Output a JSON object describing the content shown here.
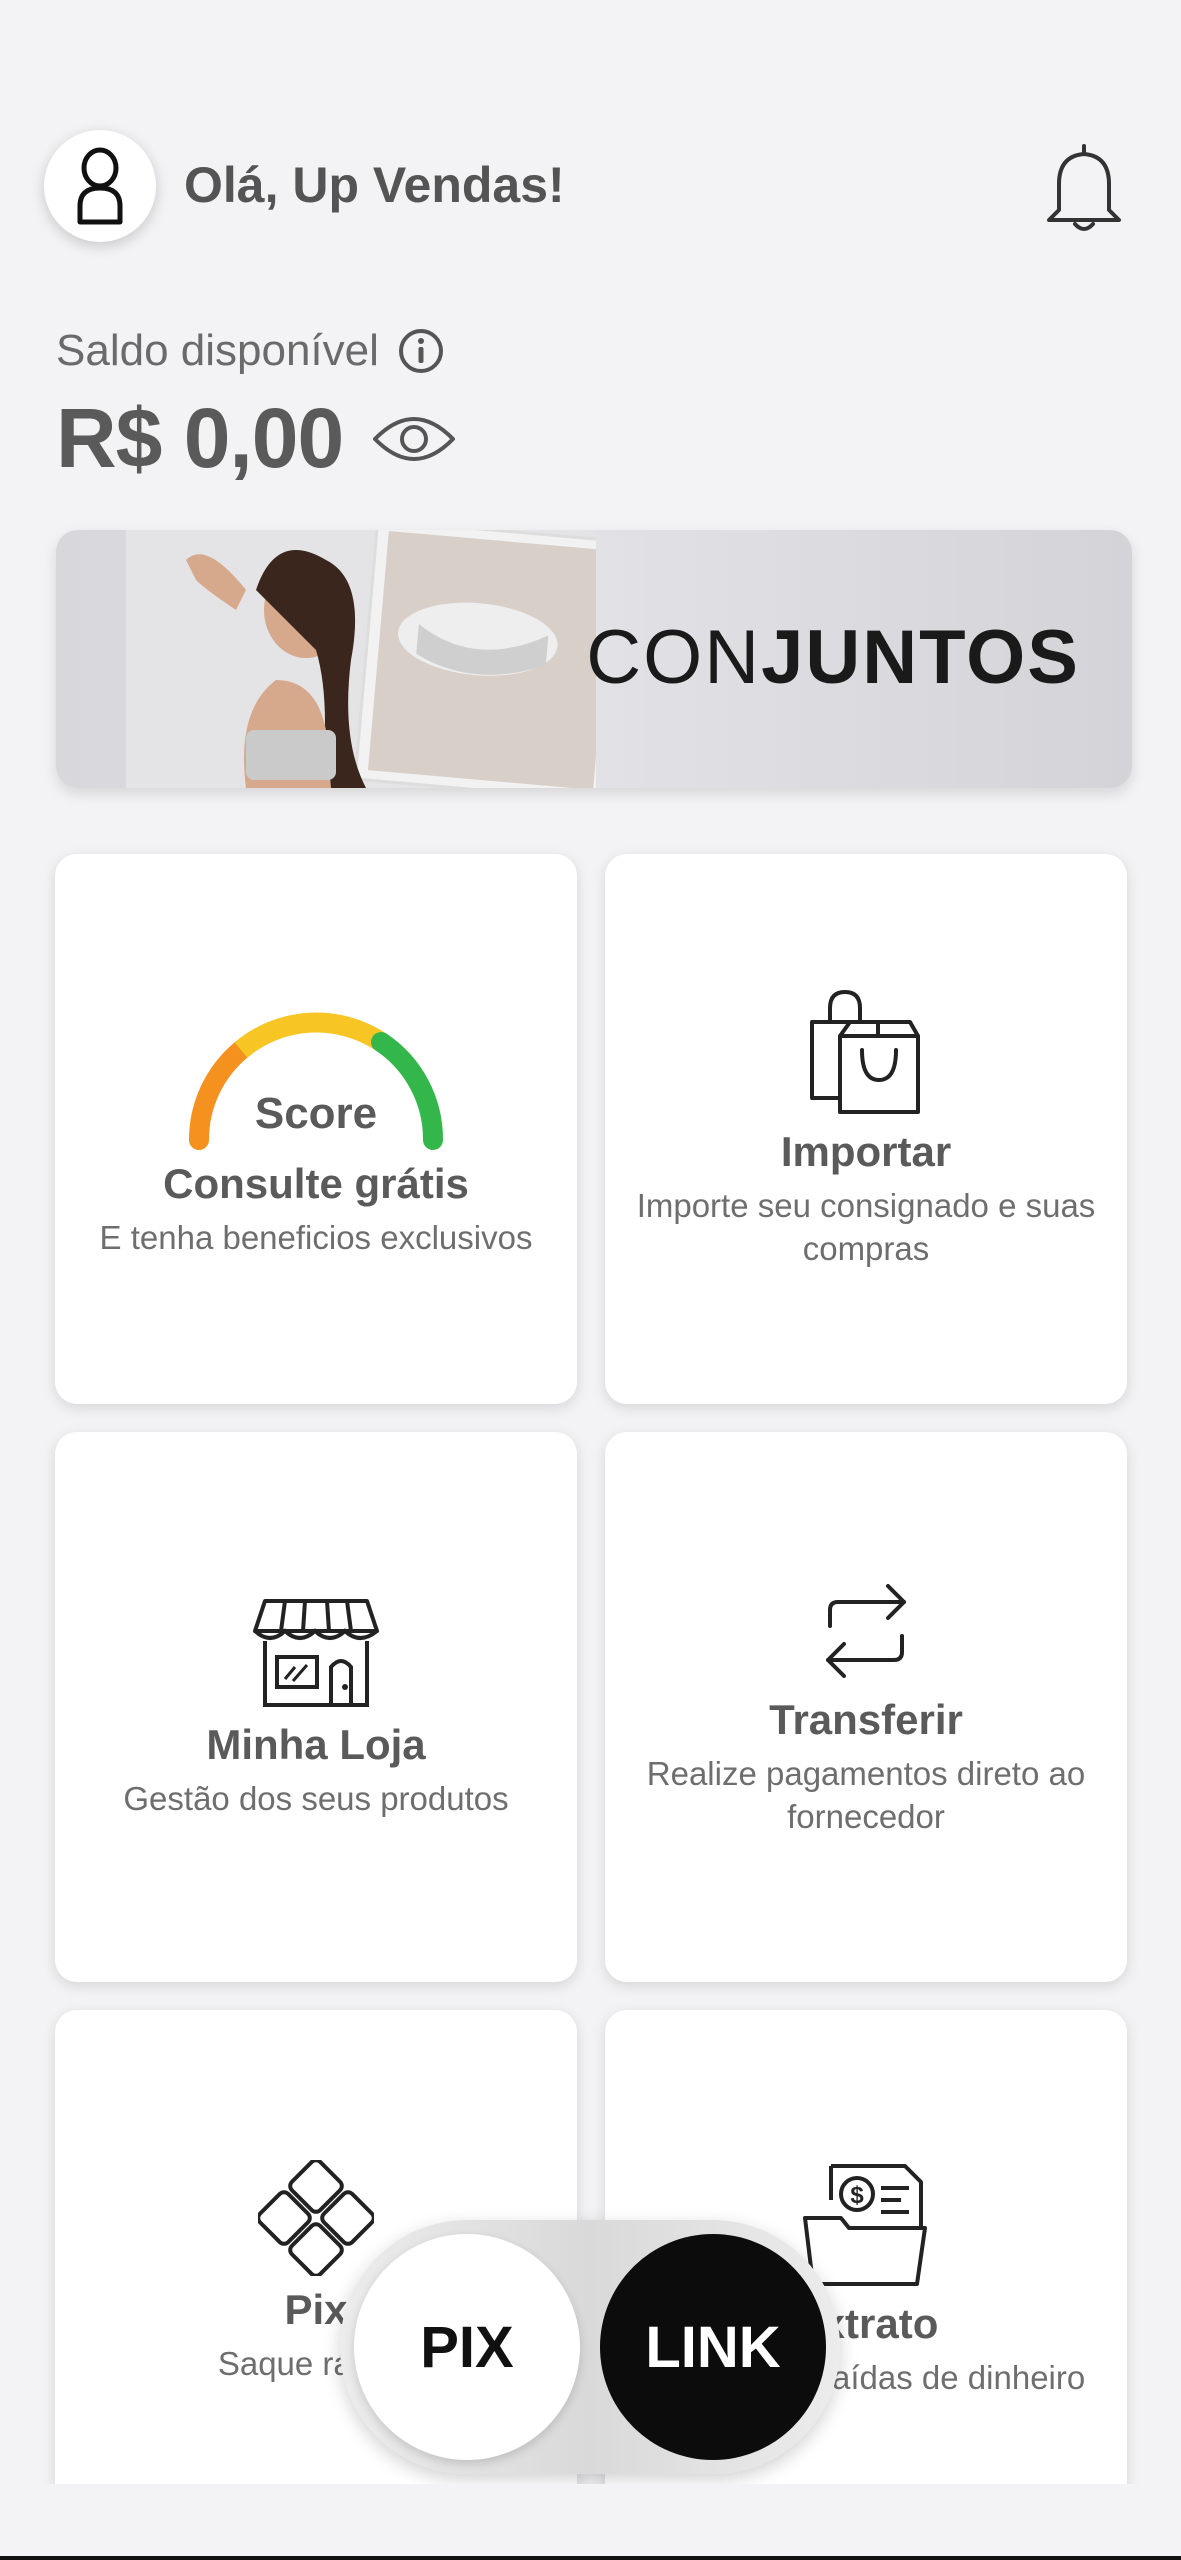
{
  "header": {
    "greeting": "Olá, Up Vendas!",
    "avatar_icon": "person-icon",
    "notification_icon": "bell-icon"
  },
  "balance": {
    "label": "Saldo disponível",
    "value": "R$ 0,00",
    "info_icon": "info-icon",
    "visibility_icon": "eye-icon"
  },
  "banner": {
    "text_light": "CON",
    "text_bold": "JUNTOS"
  },
  "cards": [
    {
      "title": "Consulte grátis",
      "sub": "E tenha beneficios exclusivos",
      "icon": "score-gauge-icon",
      "icon_text": "Score"
    },
    {
      "title": "Importar",
      "sub": "Importe seu consignado e suas compras",
      "icon": "shopping-bags-icon"
    },
    {
      "title": "Minha Loja",
      "sub": "Gestão dos seus produtos",
      "icon": "store-icon"
    },
    {
      "title": "Transferir",
      "sub": "Realize pagamentos direto ao fornecedor",
      "icon": "transfer-arrows-icon"
    },
    {
      "title": "Pix",
      "sub": "Saque rápido",
      "icon": "pix-icon"
    },
    {
      "title": "Extrato",
      "sub": "Entradas e saídas de dinheiro",
      "icon": "statement-icon"
    }
  ],
  "fab": {
    "pix_label": "PIX",
    "link_label": "LINK"
  },
  "colors": {
    "background": "#f3f3f5",
    "gauge_orange": "#f5911e",
    "gauge_yellow": "#f7c624",
    "gauge_green": "#33b74a",
    "link_button": "#0c0c0c"
  }
}
